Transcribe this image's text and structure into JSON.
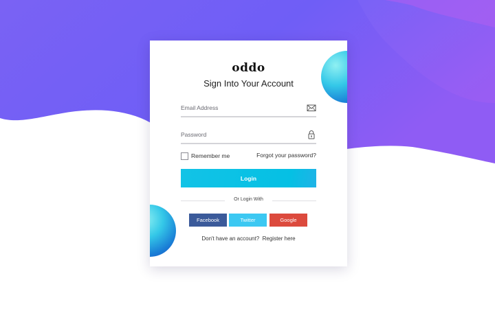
{
  "brand": {
    "logo": "oddo"
  },
  "login_form": {
    "title": "Sign Into Your Account",
    "email": {
      "placeholder": "Email Address",
      "value": "",
      "icon": "envelope-icon"
    },
    "password": {
      "placeholder": "Password",
      "value": "",
      "icon": "lock-icon"
    },
    "remember_me": {
      "label": "Remember me",
      "checked": false
    },
    "forgot_password_label": "Forgot your password?",
    "login_button_label": "Login",
    "divider_label": "Or Login With",
    "social_buttons": [
      {
        "label": "Facebook",
        "color": "#3b5a9a"
      },
      {
        "label": "Twitter",
        "color": "#3cc8f2"
      },
      {
        "label": "Google",
        "color": "#dc4a3d"
      }
    ],
    "register_prompt": "Don't have an account?",
    "register_link": "Register here"
  },
  "colors": {
    "accent": "#05c0e4",
    "background_wave_start": "#6a5cf6",
    "background_wave_end": "#9c5cf2"
  }
}
